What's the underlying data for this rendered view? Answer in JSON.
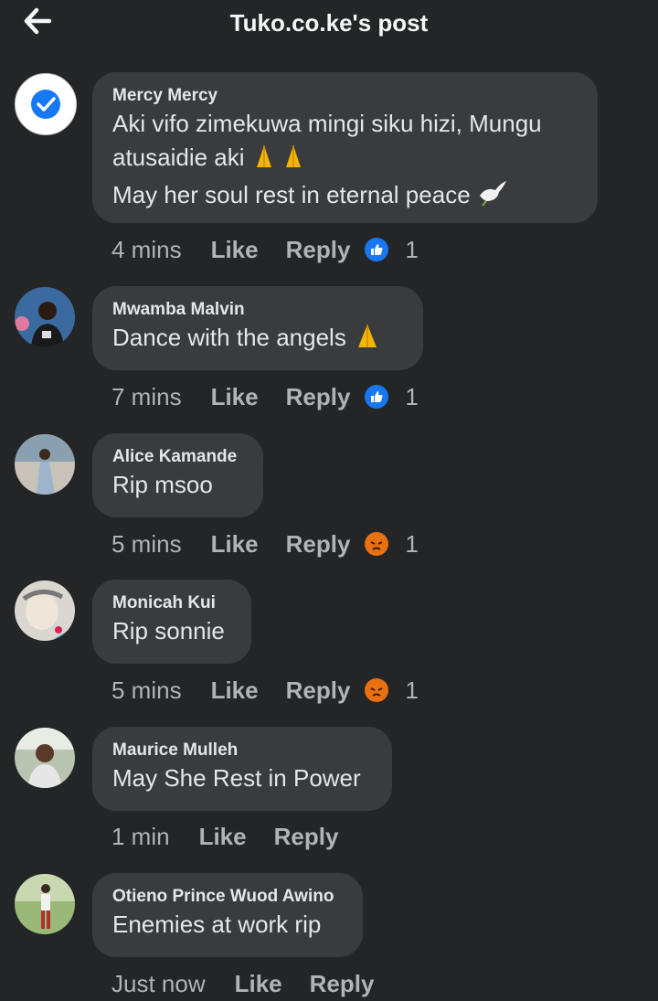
{
  "header": {
    "title": "Tuko.co.ke's post"
  },
  "comments": [
    {
      "author": "Mercy Mercy",
      "lines": [
        "Aki vifo zimekuwa mingi siku hizi, Mungu",
        "atusaidie aki",
        "May her soul rest in eternal peace"
      ],
      "time": "4 mins",
      "like": "Like",
      "reply": "Reply",
      "reaction": "like-icon",
      "reaction_count": "1"
    },
    {
      "author": "Mwamba Malvin",
      "lines": [
        "Dance with the angels"
      ],
      "time": "7 mins",
      "like": "Like",
      "reply": "Reply",
      "reaction": "like-icon",
      "reaction_count": "1"
    },
    {
      "author": "Alice Kamande",
      "lines": [
        "Rip msoo"
      ],
      "time": "5 mins",
      "like": "Like",
      "reply": "Reply",
      "reaction": "angry-icon",
      "reaction_count": "1"
    },
    {
      "author": "Monicah Kui",
      "lines": [
        "Rip sonnie"
      ],
      "time": "5 mins",
      "like": "Like",
      "reply": "Reply",
      "reaction": "angry-icon",
      "reaction_count": "1"
    },
    {
      "author": "Maurice Mulleh",
      "lines": [
        "May She Rest in Power"
      ],
      "time": "1 min",
      "like": "Like",
      "reply": "Reply"
    },
    {
      "author": "Otieno Prince Wuod Awino",
      "lines": [
        "Enemies at work rip"
      ],
      "time": "Just now",
      "like": "Like",
      "reply": "Reply"
    }
  ],
  "colors": {
    "background": "#242526",
    "bubble": "#3a3b3c",
    "like_blue": "#1877f2",
    "angry_orange": "#e9710f"
  }
}
